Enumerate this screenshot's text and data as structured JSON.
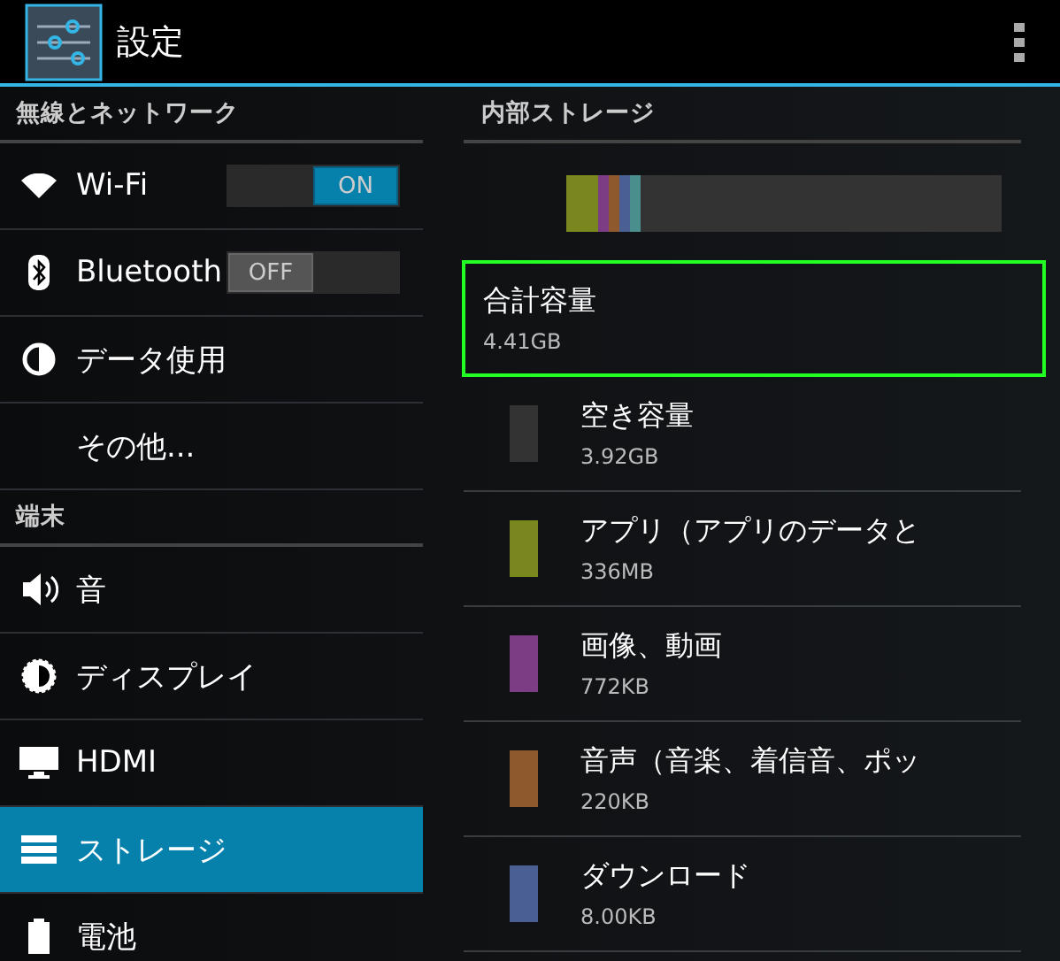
{
  "action_bar": {
    "title": "設定"
  },
  "sidebar": {
    "sections": [
      {
        "header": "無線とネットワーク",
        "items": [
          {
            "label": "Wi-Fi",
            "selected": false,
            "toggle": {
              "on": true,
              "label": "ON"
            }
          },
          {
            "label": "Bluetooth",
            "selected": false,
            "toggle": {
              "on": false,
              "label": "OFF"
            }
          },
          {
            "label": "データ使用",
            "selected": false
          },
          {
            "label": "その他...",
            "selected": false
          }
        ]
      },
      {
        "header": "端末",
        "items": [
          {
            "label": "音",
            "selected": false
          },
          {
            "label": "ディスプレイ",
            "selected": false
          },
          {
            "label": "HDMI",
            "selected": false
          },
          {
            "label": "ストレージ",
            "selected": true
          },
          {
            "label": "電池",
            "selected": false
          }
        ]
      }
    ]
  },
  "storage": {
    "header": "内部ストレージ",
    "total": {
      "title": "合計容量",
      "value": "4.41GB",
      "highlighted": true
    },
    "items": [
      {
        "title": "空き容量",
        "value": "3.92GB",
        "color": "#333333"
      },
      {
        "title": "アプリ（アプリのデータと",
        "value": "336MB",
        "color": "#7a861e"
      },
      {
        "title": "画像、動画",
        "value": "772KB",
        "color": "#7c3d84"
      },
      {
        "title": "音声（音楽、着信音、ポッ",
        "value": "220KB",
        "color": "#8e5a2d"
      },
      {
        "title": "ダウンロード",
        "value": "8.00KB",
        "color": "#4a6094"
      }
    ]
  }
}
